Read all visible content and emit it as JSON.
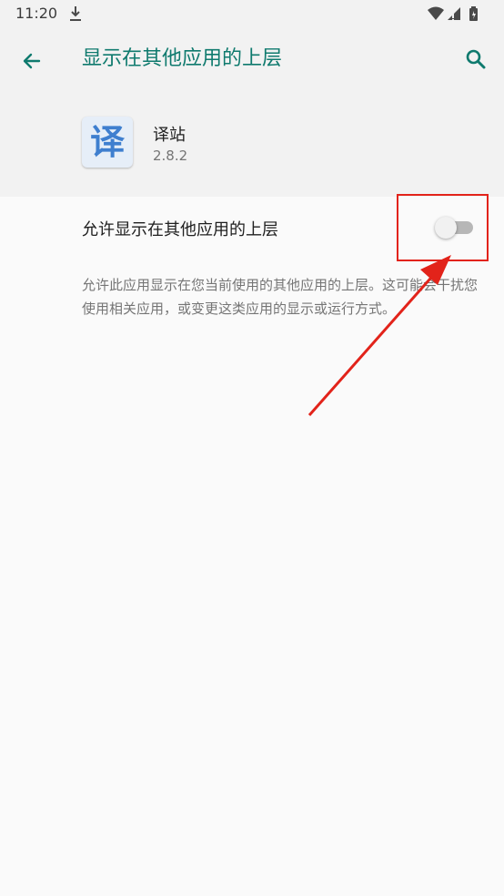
{
  "status_bar": {
    "time": "11:20",
    "icons": [
      "download-icon",
      "wifi-icon",
      "signal-icon",
      "battery-icon"
    ]
  },
  "app_bar": {
    "title": "显示在其他应用的上层",
    "back_icon": "arrow-back-icon",
    "search_icon": "search-icon",
    "accent_color": "#0f7a6e"
  },
  "app_info": {
    "icon_glyph": "译",
    "name": "译站",
    "version": "2.8.2"
  },
  "permission": {
    "label": "允许显示在其他应用的上层",
    "enabled": false,
    "summary": "允许此应用显示在您当前使用的其他应用的上层。这可能会干扰您使用相关应用，或变更这类应用的显示或运行方式。"
  },
  "annotation": {
    "color": "#e2231a"
  }
}
